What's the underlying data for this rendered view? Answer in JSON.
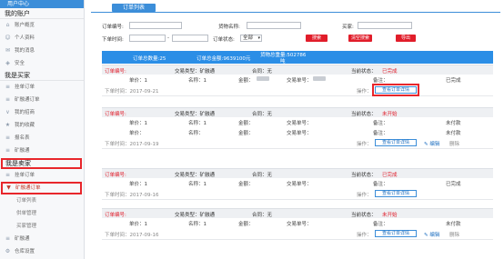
{
  "sidebar": {
    "header": "用户中心",
    "groups": [
      {
        "title": "我的账户",
        "items": [
          {
            "label": "账户概览",
            "icon": "home-icon"
          },
          {
            "label": "个人资料",
            "icon": "user-icon"
          },
          {
            "label": "我的消息",
            "icon": "message-icon"
          },
          {
            "label": "安全",
            "icon": "shield-icon"
          }
        ]
      },
      {
        "title": "我是买家",
        "items": [
          {
            "label": "挂单订单",
            "icon": "list-icon"
          },
          {
            "label": "矿融通订单",
            "icon": "list-icon"
          },
          {
            "label": "我的招商",
            "icon": "chevron-icon"
          },
          {
            "label": "我的收藏",
            "icon": "star-icon"
          },
          {
            "label": "报名表",
            "icon": "list-icon"
          },
          {
            "label": "矿融通",
            "icon": "list-icon"
          }
        ]
      },
      {
        "title": "我是卖家",
        "items": [
          {
            "label": "挂单订单",
            "icon": "list-icon"
          },
          {
            "label": "矿融通订单",
            "icon": "chevron-down-icon"
          }
        ],
        "subitems": [
          "订单列表",
          "供单管理",
          "买家管理"
        ]
      },
      {
        "title": "",
        "items": [
          {
            "label": "矿融通",
            "icon": "list-icon"
          },
          {
            "label": "仓库设置",
            "icon": "gear-icon"
          }
        ]
      }
    ]
  },
  "tab": "订单列表",
  "filters": {
    "order_no_label": "订单编号:",
    "goods_label": "货物名称:",
    "buyer_label": "买家:",
    "time_label": "下单时间:",
    "dash": "-",
    "status_label": "订单状态:",
    "status_value": "全部",
    "search_btn": "搜索",
    "reset_btn": "清空搜索",
    "export_btn": "导出"
  },
  "summary": {
    "count": "订单总数量:25",
    "amount": "订单总金额:9639100元",
    "weight_line1": "货物总重量:502786",
    "weight_line2": "吨"
  },
  "orders": [
    {
      "no_label": "订单编号:",
      "trade_type": "交易类型：矿融通",
      "contract": "合同：无",
      "status_label": "当前状态：",
      "status": "已完成",
      "price": "单价：1",
      "name": "名称：1",
      "amount": "金额：",
      "trade_no": "交易单号：",
      "note": "备注：",
      "state": "已完成",
      "time": "下单时间：2017-09-21",
      "op": "操作：",
      "detail_btn": "查看订单详情",
      "extra": ""
    },
    {
      "no_label": "订单编号:",
      "trade_type": "交易类型：矿融通",
      "contract": "合同：无",
      "status_label": "当前状态：",
      "status": "未开始",
      "price": "单价：1",
      "name": "名称：1",
      "amount": "金额：",
      "trade_no": "交易单号：",
      "note": "备注：",
      "state": "未付款",
      "price2": "单价：",
      "name2": "名称：",
      "amount2": "金额：",
      "trade_no2": "交易单号：",
      "note2": "备注：",
      "state2": "未付款",
      "time": "下单时间：2017-09-19",
      "op": "操作：",
      "detail_btn": "查看订单详情",
      "extra": "✎ 编辑",
      "extra2": "删除"
    },
    {
      "no_label": "订单编号:",
      "trade_type": "交易类型：矿融通",
      "contract": "合同：无",
      "status_label": "当前状态：",
      "status": "已完成",
      "price": "单价：1",
      "name": "名称：1",
      "amount": "金额：",
      "trade_no": "交易单号：",
      "note": "备注：",
      "state": "已完成",
      "time": "下单时间：2017-09-16",
      "op": "操作：",
      "detail_btn": "查看订单详情",
      "extra": ""
    },
    {
      "no_label": "订单编号:",
      "trade_type": "交易类型：矿融通",
      "contract": "合同：无",
      "status_label": "当前状态：",
      "status": "未开始",
      "price": "单价：1",
      "name": "名称：1",
      "amount": "金额：",
      "trade_no": "交易单号：",
      "note": "备注：",
      "state": "未付款",
      "time": "下单时间：2017-09-16",
      "op": "操作：",
      "detail_btn": "查看订单详情",
      "extra": "✎ 编辑",
      "extra2": "删除"
    }
  ],
  "colors": {
    "accent": "#3c8ed9",
    "summary_bg": "#2b8ee6",
    "danger": "#e11d2a",
    "highlight": "#e8262b"
  }
}
